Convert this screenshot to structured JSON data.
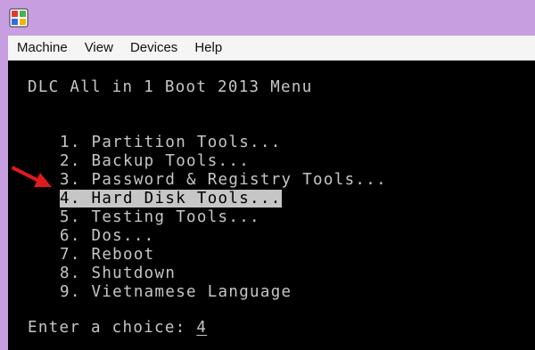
{
  "menubar": {
    "items": [
      "Machine",
      "View",
      "Devices",
      "Help"
    ]
  },
  "console": {
    "title": "DLC All in 1 Boot 2013 Menu",
    "options": [
      "1. Partition Tools...",
      "2. Backup Tools...",
      "3. Password & Registry Tools...",
      "4. Hard Disk Tools...",
      "5. Testing Tools...",
      "6. Dos...",
      "7. Reboot",
      "8. Shutdown",
      "9. Vietnamese Language"
    ],
    "selected_index": 3,
    "prompt_label": "Enter a choice: ",
    "prompt_value": "4"
  },
  "icons": {
    "app": "virtualbox-app-icon",
    "arrow": "red-arrow-icon"
  },
  "colors": {
    "titlebar": "#c79fe0",
    "console_bg": "#000000",
    "console_text": "#c6c6c6",
    "arrow": "#e01b1b"
  }
}
